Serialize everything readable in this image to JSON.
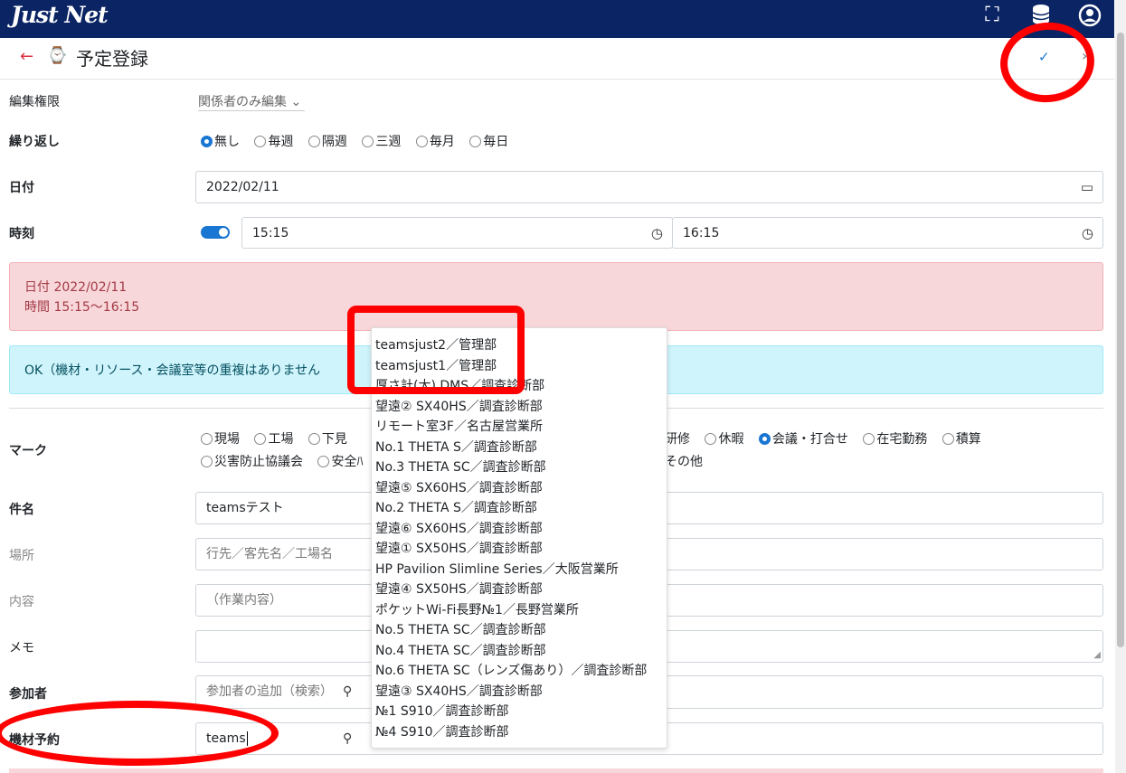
{
  "app": {
    "logo": "Just Net"
  },
  "header": {
    "back": "←",
    "title": "予定登録",
    "confirm": "✓",
    "next": "›"
  },
  "form": {
    "edit_permission": {
      "label": "編集権限",
      "value": "関係者のみ編集"
    },
    "repeat": {
      "label": "繰り返し",
      "options": [
        "無し",
        "毎週",
        "隔週",
        "三週",
        "毎月",
        "毎日"
      ],
      "selected": "無し"
    },
    "date": {
      "label": "日付",
      "value": "2022/02/11"
    },
    "time": {
      "label": "時刻",
      "start": "15:15",
      "end": "16:15",
      "allday_toggle": true
    },
    "alert_date": {
      "line1": "日付 2022/02/11",
      "line2": "時間 15:15～16:15"
    },
    "alert_ok": "OK（機材・リソース・会議室等の重複はありません",
    "mark": {
      "label": "マーク",
      "row1_left": [
        "現場",
        "工場",
        "下見"
      ],
      "row1_right": [
        "研修",
        "休暇",
        "会議・打合せ",
        "在宅勤務",
        "積算"
      ],
      "row2_left": [
        "災害防止協議会",
        "安全ﾊ"
      ],
      "row2_right": [
        "その他"
      ],
      "selected": "会議・打合せ"
    },
    "subject": {
      "label": "件名",
      "value": "teamsテスト"
    },
    "place": {
      "label": "場所",
      "placeholder": "行先／客先名／工場名"
    },
    "content": {
      "label": "内容",
      "placeholder": "（作業内容）"
    },
    "memo": {
      "label": "メモ",
      "value": ""
    },
    "participants": {
      "label": "参加者",
      "placeholder": "参加者の追加（検索）"
    },
    "equipment": {
      "label": "機材予約",
      "value": "teams"
    }
  },
  "dropdown": {
    "items": [
      "teamsjust2／管理部",
      "teamsjust1／管理部",
      "厚さ計(大) DMS／調査診断部",
      "望遠② SX40HS／調査診断部",
      "リモート室3F／名古屋営業所",
      "No.1 THETA S／調査診断部",
      "No.3 THETA SC／調査診断部",
      "望遠⑤ SX60HS／調査診断部",
      "No.2 THETA S／調査診断部",
      "望遠⑥ SX60HS／調査診断部",
      "望遠① SX50HS／調査診断部",
      "HP Pavilion Slimline Series／大阪営業所",
      "望遠④ SX50HS／調査診断部",
      "ポケットWi-Fi長野№1／長野営業所",
      "No.5 THETA SC／調査診断部",
      "No.4 THETA SC／調査診断部",
      "No.6 THETA SC（レンズ傷あり）／調査診断部",
      "望遠③ SX40HS／調査診断部",
      "№1 S910／調査診断部",
      "№4 S910／調査診断部"
    ]
  },
  "colors": {
    "header_bg": "#0b2464",
    "accent": "#1976d2",
    "annotation": "#ff0000"
  }
}
